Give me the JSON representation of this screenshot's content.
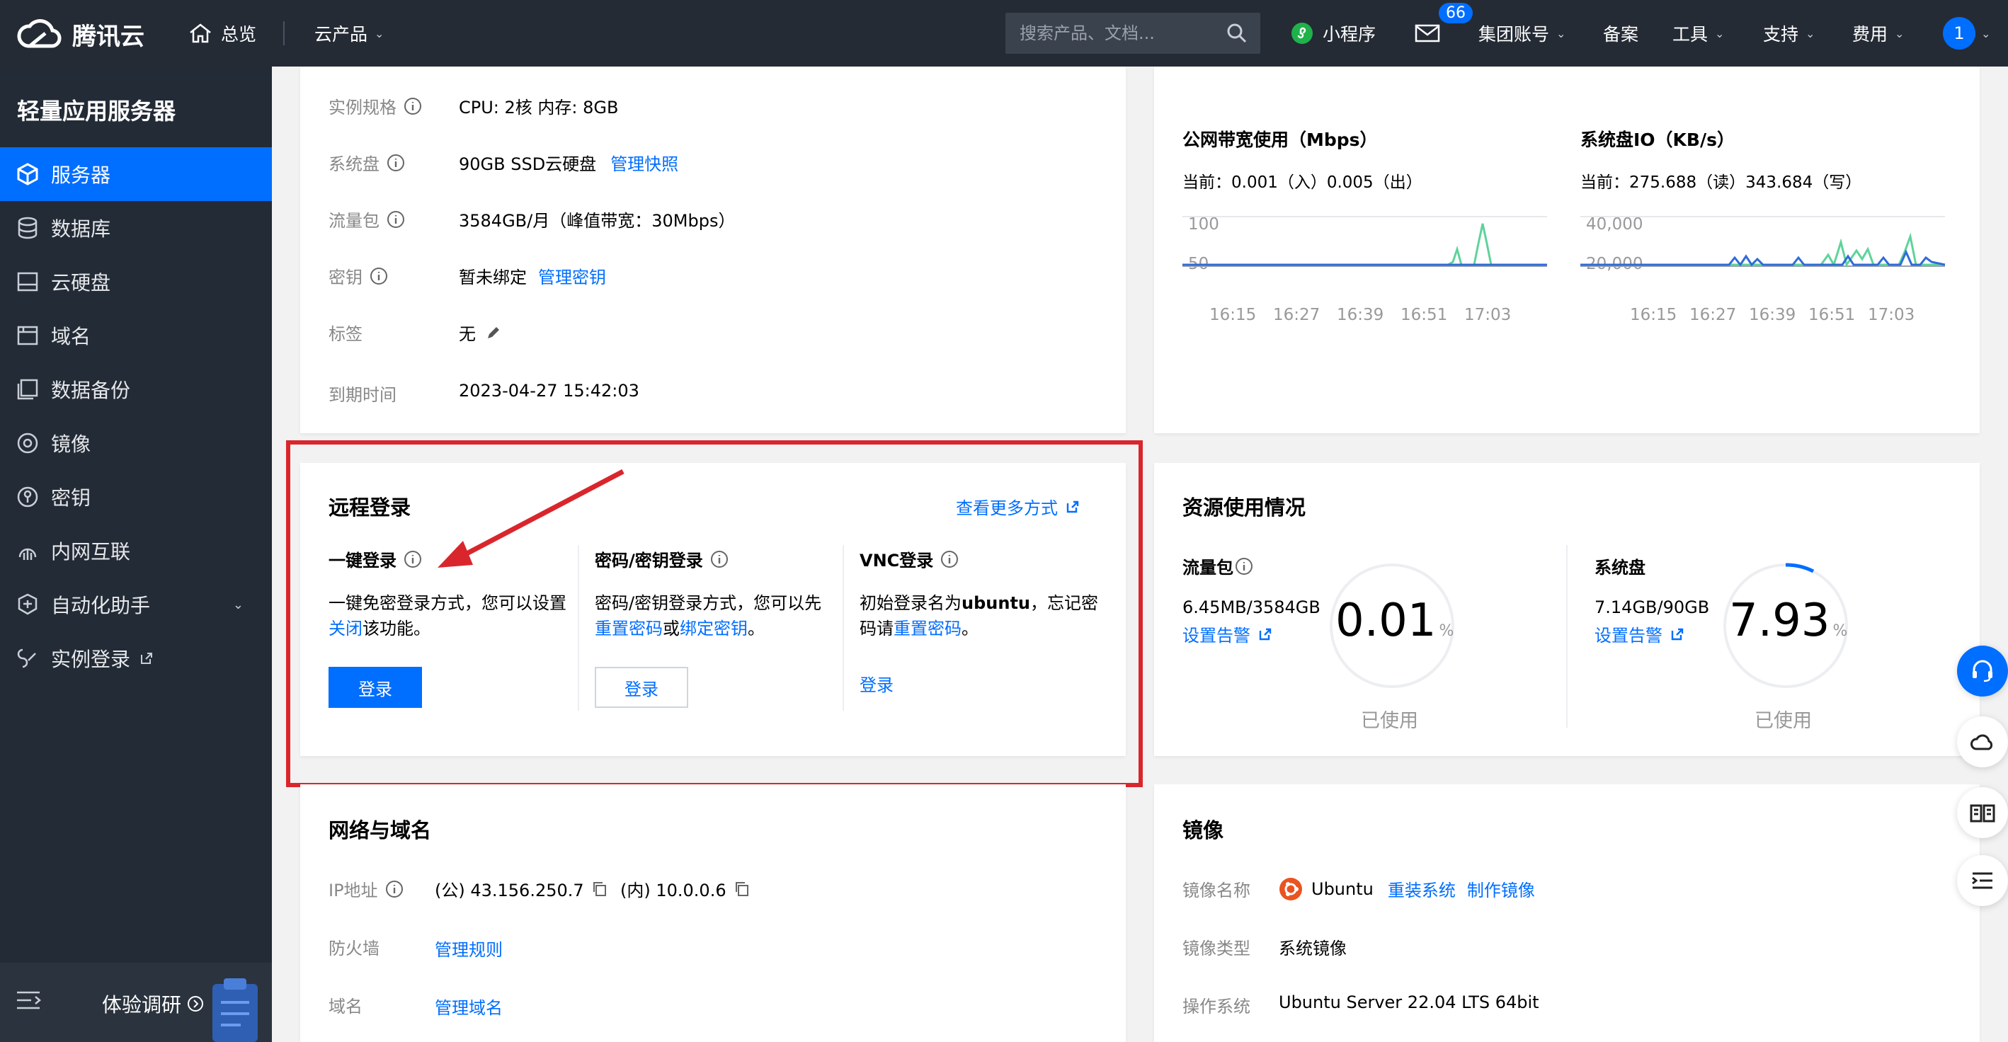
{
  "topbar": {
    "brand": "腾讯云",
    "overview": "总览",
    "products": "云产品",
    "search_placeholder": "搜索产品、文档...",
    "miniprogram": "小程序",
    "message_count": "66",
    "group_account": "集团账号",
    "filing": "备案",
    "tools": "工具",
    "support": "支持",
    "billing": "费用",
    "avatar_text": "1"
  },
  "sidebar": {
    "title": "轻量应用服务器",
    "items": [
      {
        "label": "服务器",
        "icon": "cube-icon"
      },
      {
        "label": "数据库",
        "icon": "database-icon"
      },
      {
        "label": "云硬盘",
        "icon": "disk-icon"
      },
      {
        "label": "域名",
        "icon": "domain-icon"
      },
      {
        "label": "数据备份",
        "icon": "backup-icon"
      },
      {
        "label": "镜像",
        "icon": "image-icon"
      },
      {
        "label": "密钥",
        "icon": "key-icon"
      },
      {
        "label": "内网互联",
        "icon": "network-icon"
      },
      {
        "label": "自动化助手",
        "icon": "automation-icon"
      },
      {
        "label": "实例登录",
        "icon": "login-icon"
      }
    ],
    "survey": "体验调研"
  },
  "instance": {
    "spec_label": "实例规格",
    "spec_value": "CPU: 2核 内存: 8GB",
    "disk_label": "系统盘",
    "disk_value": "90GB SSD云硬盘",
    "disk_link": "管理快照",
    "traffic_label": "流量包",
    "traffic_value": "3584GB/月（峰值带宽：30Mbps）",
    "key_label": "密钥",
    "key_value": "暂未绑定",
    "key_link": "管理密钥",
    "tag_label": "标签",
    "tag_value": "无",
    "expire_label": "到期时间",
    "expire_value": "2023-04-27 15:42:03"
  },
  "remote_login": {
    "title": "远程登录",
    "more": "查看更多方式",
    "one_click": {
      "title": "一键登录",
      "desc_pre": "一键免密登录方式，您可以设置",
      "desc_link": "关闭",
      "desc_post": "该功能。",
      "button": "登录"
    },
    "password": {
      "title": "密码/密钥登录",
      "desc_pre": "密码/密钥登录方式，您可以先",
      "link1": "重置密码",
      "mid": "或",
      "link2": "绑定密钥",
      "end": "。",
      "button": "登录"
    },
    "vnc": {
      "title": "VNC登录",
      "desc_pre": "初始登录名为",
      "desc_bold": "ubuntu",
      "desc_mid": "，忘记密码请",
      "desc_link": "重置密码",
      "desc_end": "。",
      "button": "登录"
    }
  },
  "network": {
    "title": "网络与域名",
    "ip_label": "IP地址",
    "public_ip": "(公) 43.156.250.7",
    "private_ip": "(内) 10.0.0.6",
    "firewall_label": "防火墙",
    "firewall_link": "管理规则",
    "domain_label": "域名",
    "domain_link": "管理域名"
  },
  "monitor": {
    "bandwidth": {
      "title": "公网带宽使用（Mbps）",
      "current_prefix": "当前：",
      "current": "0.001（入）0.005（出）",
      "y_ticks": [
        "100",
        "50"
      ],
      "x_ticks": [
        "16:15",
        "16:27",
        "16:39",
        "16:51",
        "17:03"
      ]
    },
    "disk_io": {
      "title": "系统盘IO（KB/s）",
      "current_prefix": "当前：",
      "current": "275.688（读）343.684（写）",
      "y_ticks": [
        "40,000",
        "20,000"
      ],
      "x_ticks": [
        "16:15",
        "16:27",
        "16:39",
        "16:51",
        "17:03"
      ]
    }
  },
  "resource": {
    "title": "资源使用情况",
    "traffic": {
      "label": "流量包",
      "value": "6.45MB/3584GB",
      "alert": "设置告警",
      "percent": "0.01",
      "unit": "%",
      "used": "已使用"
    },
    "disk": {
      "label": "系统盘",
      "value": "7.14GB/90GB",
      "alert": "设置告警",
      "percent": "7.93",
      "unit": "%",
      "used": "已使用"
    }
  },
  "image": {
    "title": "镜像",
    "name_label": "镜像名称",
    "name_value": "Ubuntu",
    "reinstall": "重装系统",
    "make": "制作镜像",
    "type_label": "镜像类型",
    "type_value": "系统镜像",
    "os_label": "操作系统",
    "os_value": "Ubuntu Server 22.04 LTS 64bit"
  },
  "colors": {
    "accent": "#006eff",
    "sidebar_bg": "#232b36",
    "highlight_border": "#d9262c",
    "chart_green": "#5ed39a",
    "chart_blue": "#2f6bd8"
  }
}
